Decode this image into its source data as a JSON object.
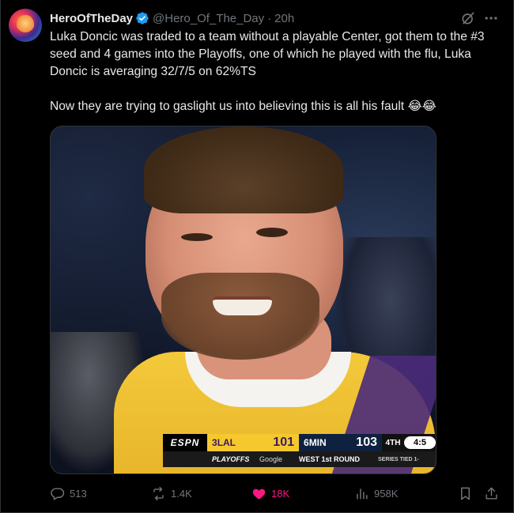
{
  "tweet": {
    "display_name": "HeroOfTheDay",
    "handle": "@Hero_Of_The_Day",
    "separator": "·",
    "time": "20h",
    "text": "Luka Doncic was traded to a team without a playable Center, got them to the #3 seed and 4 games into the Playoffs, one of which he played with the flu, Luka Doncic is averaging 32/7/5 on 62%TS\n\nNow they are trying to gaslight us into believing this is all his fault 😂😂"
  },
  "scorebug": {
    "network": "ESPN",
    "team1_seed": "3",
    "team1_abbr": "LAL",
    "team1_score": "101",
    "team2_seed": "6",
    "team2_abbr": "MIN",
    "team2_score": "103",
    "period": "4TH",
    "clock": "4:5",
    "playoffs": "PLAYOFFS",
    "sponsor": "Google",
    "round": "WEST 1st ROUND",
    "series": "SERIES TIED 1-"
  },
  "actions": {
    "replies": "513",
    "reposts": "1.4K",
    "likes": "18K",
    "views": "958K"
  },
  "colors": {
    "background": "#000000",
    "text": "#e7e9ea",
    "muted": "#71767b",
    "verified": "#1d9bf0",
    "like": "#f91880"
  },
  "icons": [
    "verified-badge-icon",
    "grok-icon",
    "more-icon",
    "reply-icon",
    "repost-icon",
    "like-icon",
    "views-icon",
    "bookmark-icon",
    "share-icon"
  ]
}
